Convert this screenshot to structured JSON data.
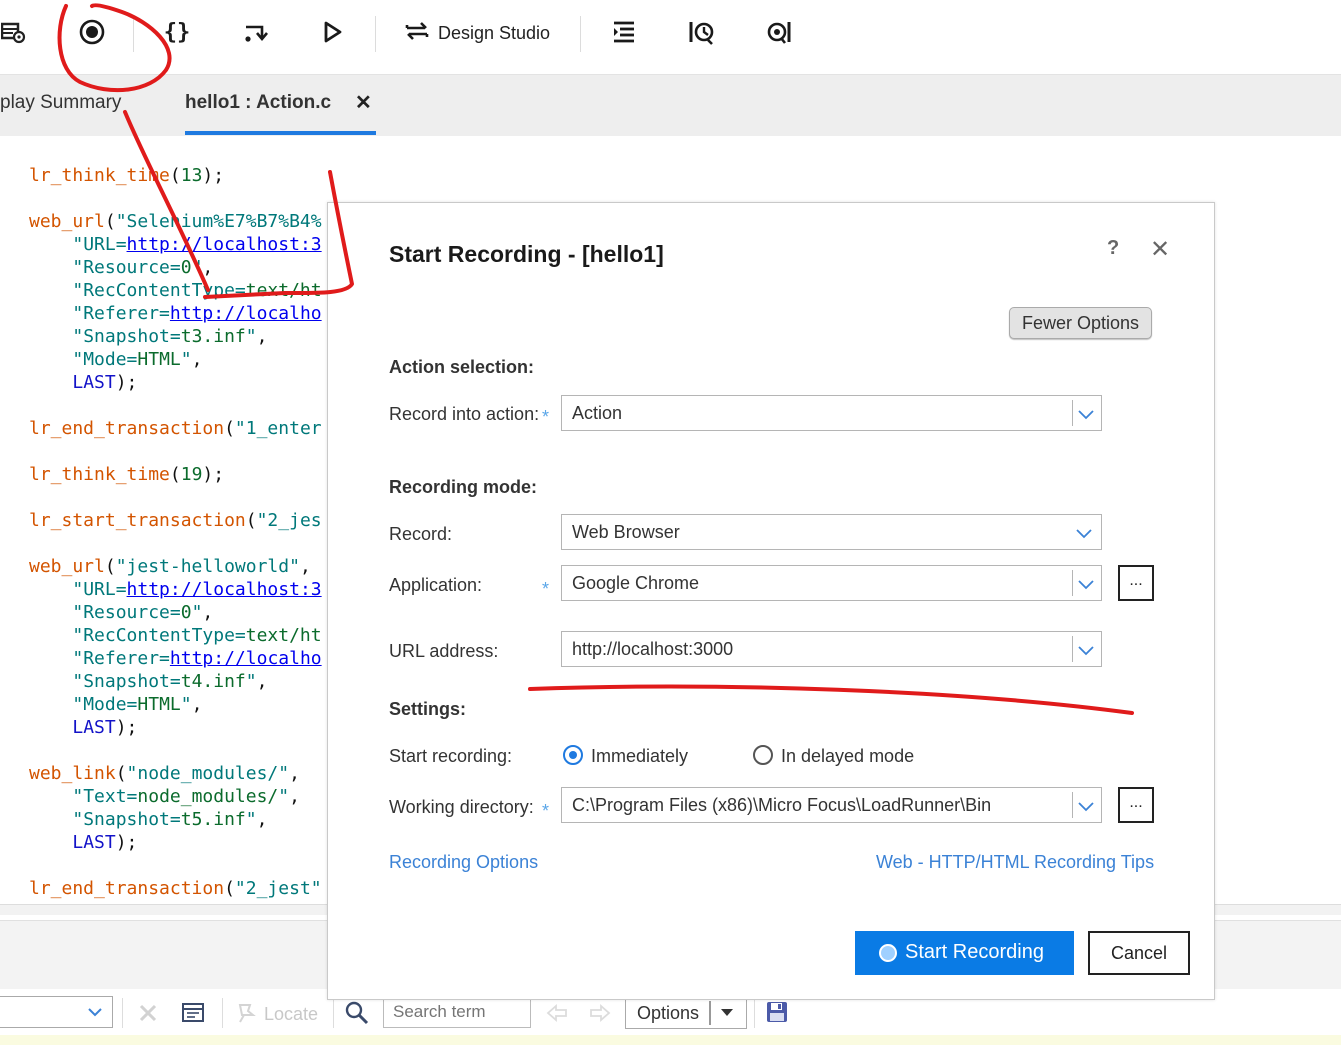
{
  "toolbar": {
    "design_studio_label": "Design Studio"
  },
  "tabs": {
    "inactive_label": "play Summary",
    "active_label": "hello1 : Action.c",
    "close_glyph": "✕"
  },
  "code": [
    [
      [
        "fn",
        "lr_think_time"
      ],
      [
        "pn",
        "("
      ],
      [
        "num",
        "13"
      ],
      [
        "pn",
        ");"
      ]
    ],
    [],
    [
      [
        "fn",
        "web_url"
      ],
      [
        "pn",
        "("
      ],
      [
        "st",
        "\"Selenium%E7%B7%B4%"
      ]
    ],
    [
      [
        "pn",
        "    "
      ],
      [
        "st",
        "\"URL="
      ],
      [
        "ul",
        "http://localhost:3"
      ]
    ],
    [
      [
        "pn",
        "    "
      ],
      [
        "st",
        "\"Resource="
      ],
      [
        "num",
        "0"
      ],
      [
        "st",
        "\""
      ],
      [
        "pn",
        ","
      ]
    ],
    [
      [
        "pn",
        "    "
      ],
      [
        "st",
        "\"RecContentType="
      ],
      [
        "num",
        "text/ht"
      ]
    ],
    [
      [
        "pn",
        "    "
      ],
      [
        "st",
        "\"Referer="
      ],
      [
        "ul",
        "http://localho"
      ]
    ],
    [
      [
        "pn",
        "    "
      ],
      [
        "st",
        "\"Snapshot="
      ],
      [
        "num",
        "t3.inf"
      ],
      [
        "st",
        "\""
      ],
      [
        "pn",
        ","
      ]
    ],
    [
      [
        "pn",
        "    "
      ],
      [
        "st",
        "\"Mode="
      ],
      [
        "num",
        "HTML"
      ],
      [
        "st",
        "\""
      ],
      [
        "pn",
        ","
      ]
    ],
    [
      [
        "pn",
        "    "
      ],
      [
        "kw",
        "LAST"
      ],
      [
        "pn",
        ");"
      ]
    ],
    [],
    [
      [
        "fn",
        "lr_end_transaction"
      ],
      [
        "pn",
        "("
      ],
      [
        "st",
        "\"1_enter"
      ]
    ],
    [],
    [
      [
        "fn",
        "lr_think_time"
      ],
      [
        "pn",
        "("
      ],
      [
        "num",
        "19"
      ],
      [
        "pn",
        ");"
      ]
    ],
    [],
    [
      [
        "fn",
        "lr_start_transaction"
      ],
      [
        "pn",
        "("
      ],
      [
        "st",
        "\"2_jes"
      ]
    ],
    [],
    [
      [
        "fn",
        "web_url"
      ],
      [
        "pn",
        "("
      ],
      [
        "st",
        "\"jest-helloworld\""
      ],
      [
        "pn",
        ","
      ]
    ],
    [
      [
        "pn",
        "    "
      ],
      [
        "st",
        "\"URL="
      ],
      [
        "ul",
        "http://localhost:3"
      ]
    ],
    [
      [
        "pn",
        "    "
      ],
      [
        "st",
        "\"Resource="
      ],
      [
        "num",
        "0"
      ],
      [
        "st",
        "\""
      ],
      [
        "pn",
        ","
      ]
    ],
    [
      [
        "pn",
        "    "
      ],
      [
        "st",
        "\"RecContentType="
      ],
      [
        "num",
        "text/ht"
      ]
    ],
    [
      [
        "pn",
        "    "
      ],
      [
        "st",
        "\"Referer="
      ],
      [
        "ul",
        "http://localho"
      ]
    ],
    [
      [
        "pn",
        "    "
      ],
      [
        "st",
        "\"Snapshot="
      ],
      [
        "num",
        "t4.inf"
      ],
      [
        "st",
        "\""
      ],
      [
        "pn",
        ","
      ]
    ],
    [
      [
        "pn",
        "    "
      ],
      [
        "st",
        "\"Mode="
      ],
      [
        "num",
        "HTML"
      ],
      [
        "st",
        "\""
      ],
      [
        "pn",
        ","
      ]
    ],
    [
      [
        "pn",
        "    "
      ],
      [
        "kw",
        "LAST"
      ],
      [
        "pn",
        ");"
      ]
    ],
    [],
    [
      [
        "fn",
        "web_link"
      ],
      [
        "pn",
        "("
      ],
      [
        "st",
        "\"node_modules/\""
      ],
      [
        "pn",
        ","
      ]
    ],
    [
      [
        "pn",
        "    "
      ],
      [
        "st",
        "\"Text="
      ],
      [
        "num",
        "node_modules/"
      ],
      [
        "st",
        "\""
      ],
      [
        "pn",
        ","
      ]
    ],
    [
      [
        "pn",
        "    "
      ],
      [
        "st",
        "\"Snapshot="
      ],
      [
        "num",
        "t5.inf"
      ],
      [
        "st",
        "\""
      ],
      [
        "pn",
        ","
      ]
    ],
    [
      [
        "pn",
        "    "
      ],
      [
        "kw",
        "LAST"
      ],
      [
        "pn",
        ");"
      ]
    ],
    [],
    [
      [
        "fn",
        "lr_end_transaction"
      ],
      [
        "pn",
        "("
      ],
      [
        "st",
        "\"2_jest\""
      ]
    ]
  ],
  "dialog": {
    "title": "Start Recording - [hello1]",
    "help_glyph": "?",
    "close_glyph": "✕",
    "fewer_options_label": "Fewer Options",
    "action_selection": {
      "heading": "Action selection:",
      "record_into_label": "Record into action:",
      "record_into_value": "Action"
    },
    "recording_mode": {
      "heading": "Recording mode:",
      "record_label": "Record:",
      "record_value": "Web Browser",
      "application_label": "Application:",
      "application_value": "Google Chrome",
      "url_label": "URL address:",
      "url_value": "http://localhost:3000"
    },
    "settings": {
      "heading": "Settings:",
      "start_recording_label": "Start recording:",
      "option_immediately": "Immediately",
      "option_delayed": "In delayed mode",
      "immediately_selected": true,
      "working_dir_label": "Working directory:",
      "working_dir_value": "C:\\Program Files (x86)\\Micro Focus\\LoadRunner\\Bin"
    },
    "required_marker": "*",
    "browse_label": "...",
    "recording_options_link": "Recording Options",
    "tips_link": "Web - HTTP/HTML Recording Tips",
    "start_button_label": "Start Recording",
    "cancel_button_label": "Cancel"
  },
  "bottom_toolbar": {
    "locate_label": "Locate",
    "search_placeholder": "Search term",
    "options_label": "Options"
  },
  "colors": {
    "accent": "#0a7be5",
    "link": "#3b82d6",
    "annotation": "#e01b1b",
    "code_function": "#d35400",
    "code_string": "#00787a",
    "code_value": "#0b6b2c",
    "code_keyword": "#1313c8"
  }
}
